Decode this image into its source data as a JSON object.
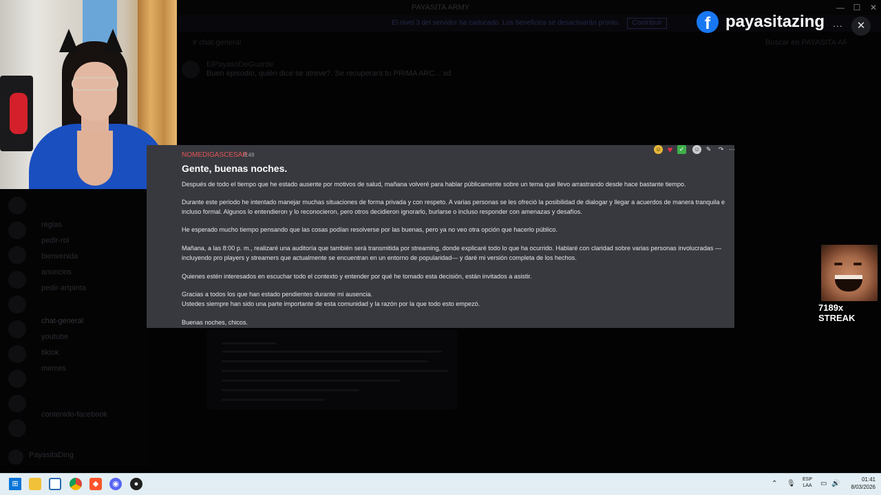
{
  "window": {
    "title": "PAYASITA ARMY",
    "minimize": "—",
    "maximize": "☐",
    "close": "✕"
  },
  "notice": {
    "text": "El nivel 3 del servidor ha caducado. Los beneficios se desactivarán pronto.",
    "button": "Contribuir"
  },
  "channel_header": {
    "name": "chat-general",
    "search_placeholder": "Buscar en PAYASITA ARMY"
  },
  "background_message": {
    "author": "ElPayasoDeGuarde",
    "text": "Buen episodio, quién dice se atreve?. Se recuperara tu PRIMA ARC... xd"
  },
  "sidebar": {
    "items": [
      "reglas",
      "pedir-rol",
      "bienvenida",
      "anuncios",
      "pedir-artpinta",
      "chat-general",
      "youtube",
      "tiktok",
      "memes",
      "contenido-facebook"
    ],
    "user": "PayasitaDing"
  },
  "facebook_overlay": {
    "name": "payasitazing",
    "icon": "facebook-icon",
    "more": "...",
    "close": "✕"
  },
  "message": {
    "author": "NOMEDIGASCESAR",
    "time": "0:48",
    "heading": "Gente, buenas noches.",
    "paragraphs": [
      "Después de todo el tiempo que he estado ausente por motivos de salud, mañana volveré para hablar públicamente sobre un tema que llevo arrastrando desde hace bastante tiempo.",
      "Durante este periodo he intentado manejar muchas situaciones de forma privada y con respeto. A varias personas se les ofreció la posibilidad de dialogar y llegar a acuerdos de manera tranquila e incluso formal. Algunos lo entendieron y lo reconocieron, pero otros decidieron ignorarlo, burlarse o incluso responder con amenazas y desafíos.",
      "He esperado mucho tiempo pensando que las cosas podían resolverse por las buenas, pero ya no veo otra opción que hacerlo público.",
      "Mañana, a las 8:00 p. m., realizaré una auditoría que también será transmitida por streaming, donde explicaré todo lo que ha ocurrido. Hablaré con claridad sobre varias personas involucradas — incluyendo pro players y streamers que actualmente se encuentran en un entorno de popularidad— y daré mi versión completa de los hechos.",
      "Quienes estén interesados en escuchar todo el contexto y entender por qué he tomado esta decisión, están invitados a asistir.",
      "Gracias a todos los que han estado pendientes durante mi ausencia.",
      "Ustedes siempre han sido una parte importante de esta comunidad y la razón por la que todo esto empezó.",
      "Buenas noches, chicos."
    ],
    "toolbar": [
      "laugh-emoji-icon",
      "heart-emoji-icon",
      "check-emoji-icon",
      "add-reaction-icon",
      "edit-icon",
      "reply-icon",
      "more-icon"
    ]
  },
  "streak": {
    "label": "7189x STREAK"
  },
  "taskbar": {
    "apps": [
      "windows-start-icon",
      "file-explorer-icon",
      "window-app-icon",
      "chrome-icon",
      "brave-icon",
      "discord-icon",
      "obs-icon"
    ],
    "language_top": "ESP",
    "language_bottom": "LAA",
    "time": "01:41",
    "date": "8/03/2026"
  },
  "colors": {
    "card_bg": "#38393f",
    "author": "#e25656",
    "facebook": "#1877f2",
    "taskbar": "#e2eef3"
  }
}
